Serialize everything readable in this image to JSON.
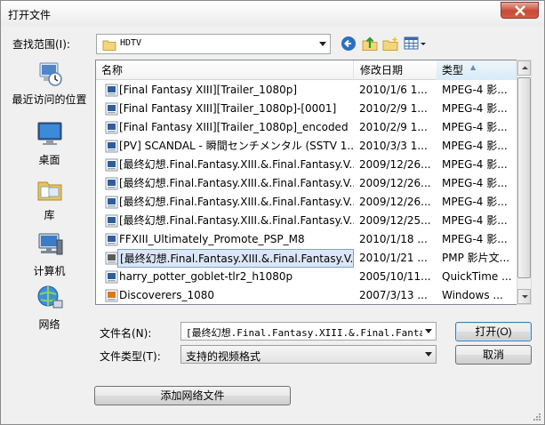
{
  "window": {
    "title": "打开文件"
  },
  "lookin": {
    "label": "查找范围(I):",
    "value": "HDTV"
  },
  "toolbar": {
    "back_icon": "back-arrow-icon",
    "up_icon": "up-folder-icon",
    "new_folder_icon": "new-folder-icon",
    "views_icon": "view-menu-icon"
  },
  "places": [
    {
      "label": "最近访问的位置",
      "icon": "recent-places-icon"
    },
    {
      "label": "桌面",
      "icon": "desktop-icon"
    },
    {
      "label": "库",
      "icon": "libraries-icon"
    },
    {
      "label": "计算机",
      "icon": "computer-icon"
    },
    {
      "label": "网络",
      "icon": "network-icon"
    }
  ],
  "columns": {
    "name": "名称",
    "date": "修改日期",
    "type": "类型"
  },
  "files": [
    {
      "name": "[Final Fantasy XIII][Trailer_1080p]",
      "date": "2010/1/6 1...",
      "type": "MPEG-4 影...",
      "icon": "video-file-icon"
    },
    {
      "name": "[Final Fantasy XIII][Trailer_1080p]-[0001]",
      "date": "2010/2/9 1...",
      "type": "MPEG-4 影...",
      "icon": "video-file-icon"
    },
    {
      "name": "[Final Fantasy XIII][Trailer_1080p]_encoded",
      "date": "2010/2/9 1...",
      "type": "MPEG-4 影...",
      "icon": "video-file-icon"
    },
    {
      "name": "[PV] SCANDAL - 瞬間センチメンタル (SSTV 1...",
      "date": "2010/3/3 1...",
      "type": "MPEG-4 影...",
      "icon": "video-file-icon"
    },
    {
      "name": "[最终幻想.Final.Fantasy.XIII.&.Final.Fantasy.V...",
      "date": "2009/12/26...",
      "type": "MPEG-4 影...",
      "icon": "video-file-icon"
    },
    {
      "name": "[最终幻想.Final.Fantasy.XIII.&.Final.Fantasy.V...",
      "date": "2009/12/26...",
      "type": "MPEG-4 影...",
      "icon": "video-file-icon"
    },
    {
      "name": "[最终幻想.Final.Fantasy.XIII.&.Final.Fantasy.V...",
      "date": "2009/12/26...",
      "type": "MPEG-4 影...",
      "icon": "video-file-icon"
    },
    {
      "name": "[最终幻想.Final.Fantasy.XIII.&.Final.Fantasy.V...",
      "date": "2009/12/25...",
      "type": "MPEG-4 影...",
      "icon": "video-file-icon"
    },
    {
      "name": "FFXIII_Ultimately_Promote_PSP_M8",
      "date": "2010/1/18 ...",
      "type": "MPEG-4 影...",
      "icon": "video-file-icon"
    },
    {
      "name": "[最终幻想.Final.Fantasy.XIII.&.Final.Fantasy.V...",
      "date": "2010/1/21 ...",
      "type": "PMP 影片文...",
      "icon": "pmp-file-icon",
      "selected": true
    },
    {
      "name": "harry_potter_goblet-tlr2_h1080p",
      "date": "2005/10/11...",
      "type": "QuickTime ...",
      "icon": "video-file-icon"
    },
    {
      "name": "Discoverers_1080",
      "date": "2007/3/13 ...",
      "type": "Windows ...",
      "icon": "wmv-file-icon"
    }
  ],
  "filename": {
    "label": "文件名(N):",
    "value": "[最终幻想.Final.Fantasy.XIII.&.Final.Fantasy"
  },
  "filetype": {
    "label": "文件类型(T):",
    "value": "支持的视频格式"
  },
  "buttons": {
    "open": "打开(O)",
    "cancel": "取消",
    "add_network": "添加网络文件"
  },
  "colors": {
    "selection": "#dbe7f5",
    "selection_border": "#7da2ce",
    "close_red": "#c74a36"
  }
}
